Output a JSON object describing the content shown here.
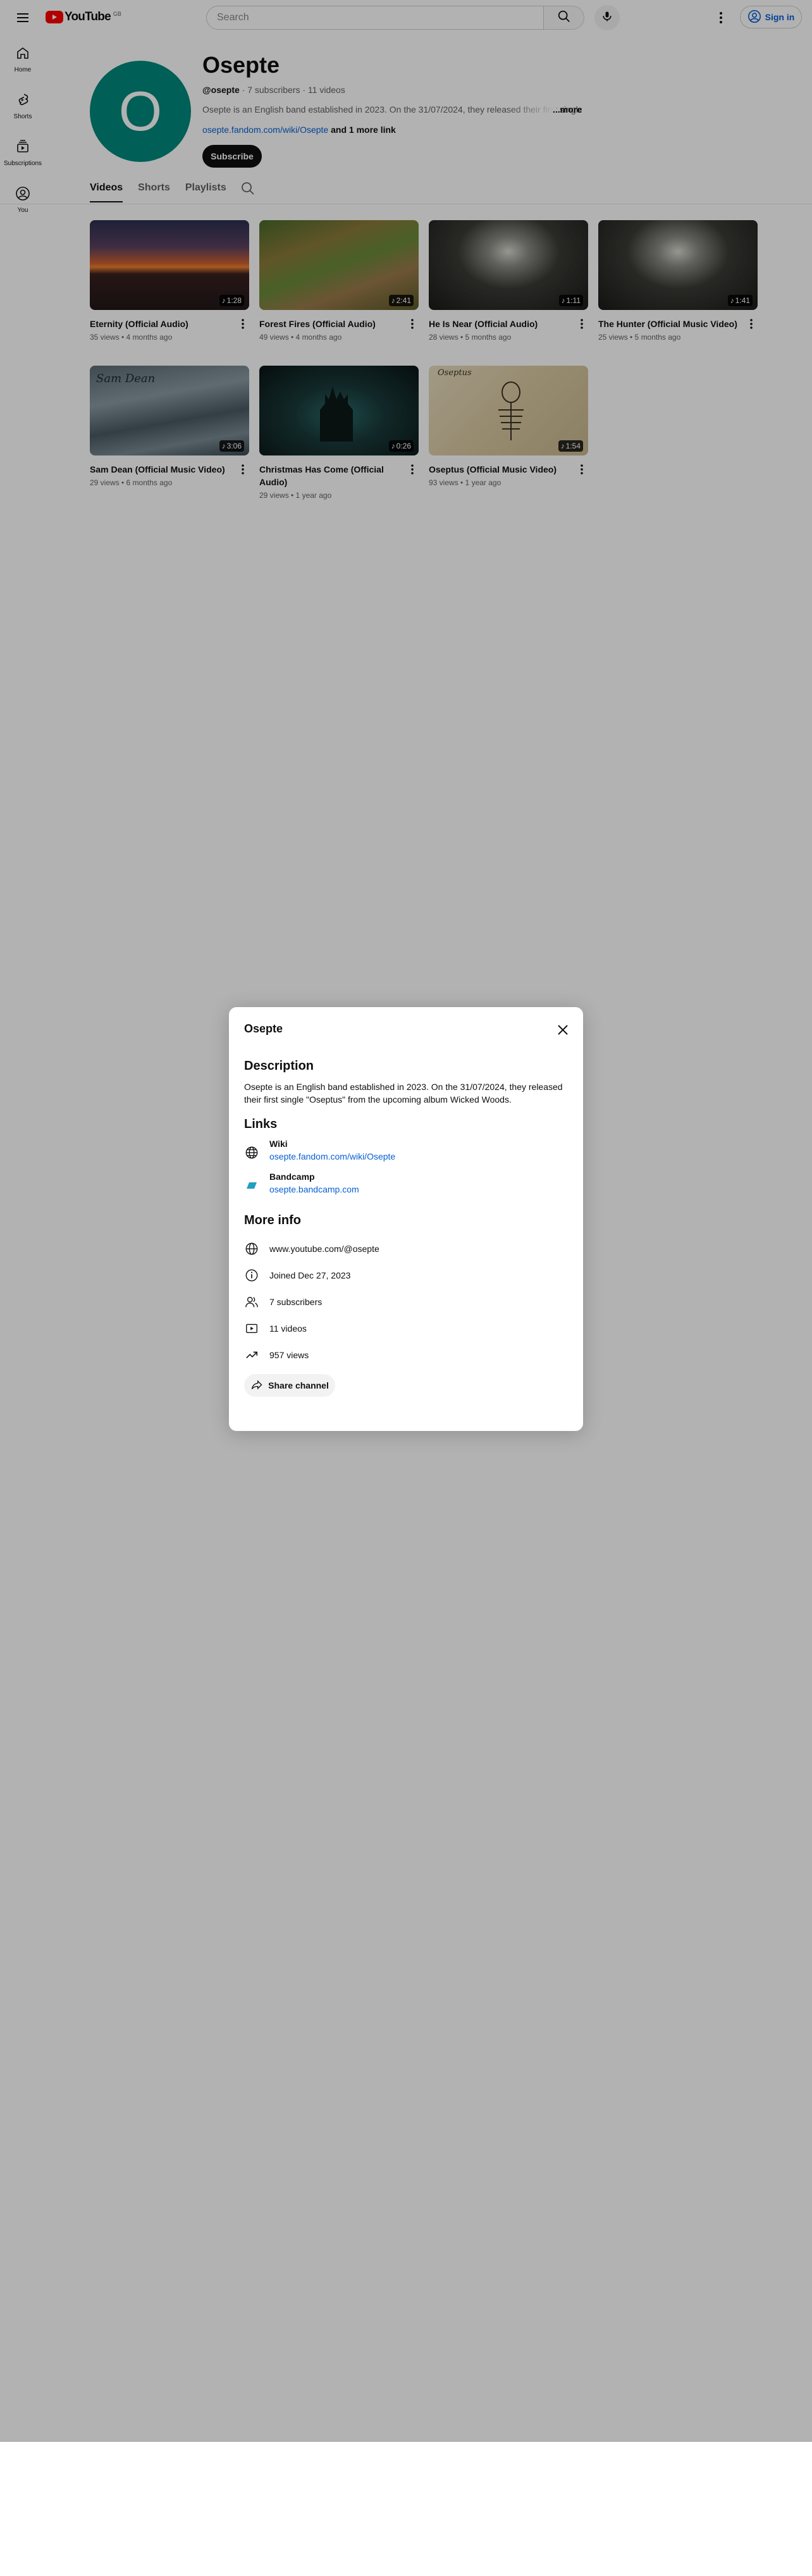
{
  "header": {
    "logo_text": "YouTube",
    "logo_sup": "GB",
    "search_placeholder": "Search",
    "signin_label": "Sign in"
  },
  "guide": {
    "items": [
      {
        "label": "Home",
        "icon": "home-icon"
      },
      {
        "label": "Shorts",
        "icon": "shorts-icon"
      },
      {
        "label": "Subscriptions",
        "icon": "subscriptions-icon"
      },
      {
        "label": "You",
        "icon": "you-icon"
      }
    ]
  },
  "channel": {
    "avatar_letter": "O",
    "name": "Osepte",
    "handle": "@osepte",
    "stats": " · 7 subscribers · 11 videos",
    "description_snippet": "Osepte is an English band established in 2023. On the 31/07/2024, they released their first single \"Oseptus\" from the upcoming album Wicked Woods.",
    "more_label": "...more",
    "link_text": "osepte.fandom.com/wiki/Osepte",
    "more_links": " and 1 more link",
    "subscribe_label": "Subscribe"
  },
  "tabs": [
    {
      "label": "Videos",
      "active": true
    },
    {
      "label": "Shorts",
      "active": false
    },
    {
      "label": "Playlists",
      "active": false
    }
  ],
  "videos": [
    {
      "title": "Eternity (Official Audio)",
      "meta": "35 views • 4 months ago",
      "duration": "1:28"
    },
    {
      "title": "Forest Fires (Official Audio)",
      "meta": "49 views • 4 months ago",
      "duration": "2:41"
    },
    {
      "title": "He Is Near (Official Audio)",
      "meta": "28 views • 5 months ago",
      "duration": "1:11"
    },
    {
      "title": "The Hunter (Official Music Video)",
      "meta": "25 views • 5 months ago",
      "duration": "1:41"
    },
    {
      "title": "Sam Dean (Official Music Video)",
      "meta": "29 views • 6 months ago",
      "duration": "3:06"
    },
    {
      "title": "Christmas Has Come (Official Audio)",
      "meta": "29 views • 1 year ago",
      "duration": "0:26"
    },
    {
      "title": "Oseptus (Official Music Video)",
      "meta": "93 views • 1 year ago",
      "duration": "1:54"
    }
  ],
  "thumb_text": {
    "sam_dean": "Sam Dean",
    "oseptus": "Oseptus"
  },
  "dialog": {
    "title": "Osepte",
    "description_heading": "Description",
    "description": "Osepte is an English band established in 2023. On the 31/07/2024, they released their first single \"Oseptus\" from the upcoming album Wicked Woods.",
    "links_heading": "Links",
    "links": [
      {
        "name": "Wiki",
        "url": "osepte.fandom.com/wiki/Osepte",
        "icon": "globe-icon"
      },
      {
        "name": "Bandcamp",
        "url": "osepte.bandcamp.com",
        "icon": "bandcamp-icon"
      }
    ],
    "more_info_heading": "More info",
    "info": [
      {
        "text": "www.youtube.com/@osepte",
        "icon": "globe-icon"
      },
      {
        "text": "Joined Dec 27, 2023",
        "icon": "info-icon"
      },
      {
        "text": "7 subscribers",
        "icon": "subscribers-icon"
      },
      {
        "text": "11 videos",
        "icon": "video-icon"
      },
      {
        "text": "957 views",
        "icon": "trending-icon"
      }
    ],
    "share_label": "Share channel"
  },
  "colors": {
    "brand_red": "#ff0000",
    "avatar_teal": "#00897b",
    "link_blue": "#065fd4",
    "bandcamp_blue": "#1da0c3"
  }
}
